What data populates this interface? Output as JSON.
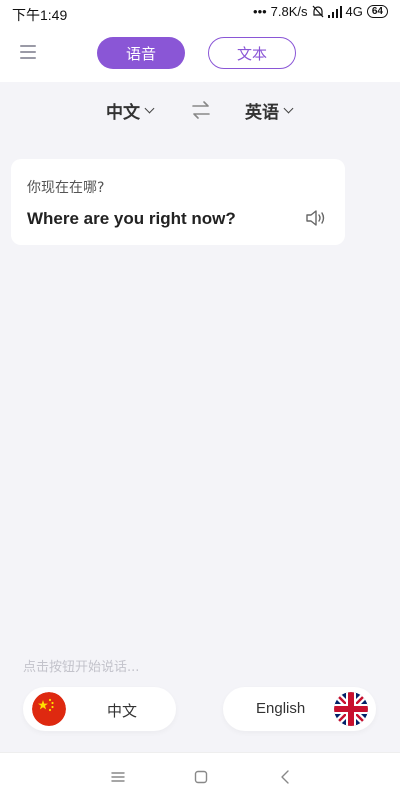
{
  "status": {
    "time": "下午1:49",
    "network_speed": "7.8K/s",
    "signal_label": "4G",
    "battery": "64"
  },
  "header": {
    "menu_icon": "hamburger-menu-icon",
    "mode_voice": "语音",
    "mode_text": "文本",
    "accent_color": "#8a56d6"
  },
  "languages": {
    "from": "中文",
    "to": "英语",
    "swap_icon": "swap-arrows-icon"
  },
  "translation": {
    "source": "你现在在哪?",
    "target": "Where are you right now?",
    "speaker_icon": "speaker-icon"
  },
  "prompt_hint": "点击按钮开始说话...",
  "speak_buttons": {
    "left_label": "中文",
    "left_flag": "china-flag-icon",
    "right_label": "English",
    "right_flag": "uk-flag-icon"
  },
  "navigation": {
    "menu_icon": "nav-menu-icon",
    "home_icon": "nav-home-icon",
    "back_icon": "nav-back-icon"
  }
}
